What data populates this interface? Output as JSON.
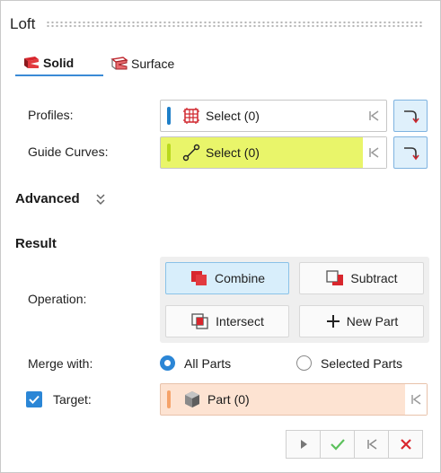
{
  "window": {
    "title": "Loft"
  },
  "tabs": [
    {
      "label": "Solid",
      "active": true,
      "icon": "loft-solid-icon"
    },
    {
      "label": "Surface",
      "active": false,
      "icon": "loft-surface-icon"
    }
  ],
  "profiles": {
    "label": "Profiles:",
    "value": "Select (0)",
    "bar_color": "#1e7fc8",
    "icon": "profile-grid-icon"
  },
  "guide_curves": {
    "label": "Guide Curves:",
    "value": "Select (0)",
    "bar_color": "#b9d81c",
    "highlight_color": "#e9f56a",
    "icon": "curve-icon"
  },
  "advanced": {
    "label": "Advanced"
  },
  "result": {
    "label": "Result",
    "operation_label": "Operation:",
    "operations": [
      {
        "label": "Combine",
        "active": true
      },
      {
        "label": "Subtract",
        "active": false
      },
      {
        "label": "Intersect",
        "active": false
      },
      {
        "label": "New Part",
        "active": false
      }
    ],
    "merge_label": "Merge with:",
    "merge_options": [
      {
        "label": "All Parts",
        "selected": true
      },
      {
        "label": "Selected Parts",
        "selected": false
      }
    ],
    "target": {
      "checked": true,
      "label": "Target:",
      "value": "Part (0)",
      "bg_color": "#fde3d2",
      "bar_color": "#f5a36a"
    }
  },
  "colors": {
    "accent": "#2b86d6",
    "ok_green": "#5cc15c",
    "cancel_red": "#d9272e"
  }
}
